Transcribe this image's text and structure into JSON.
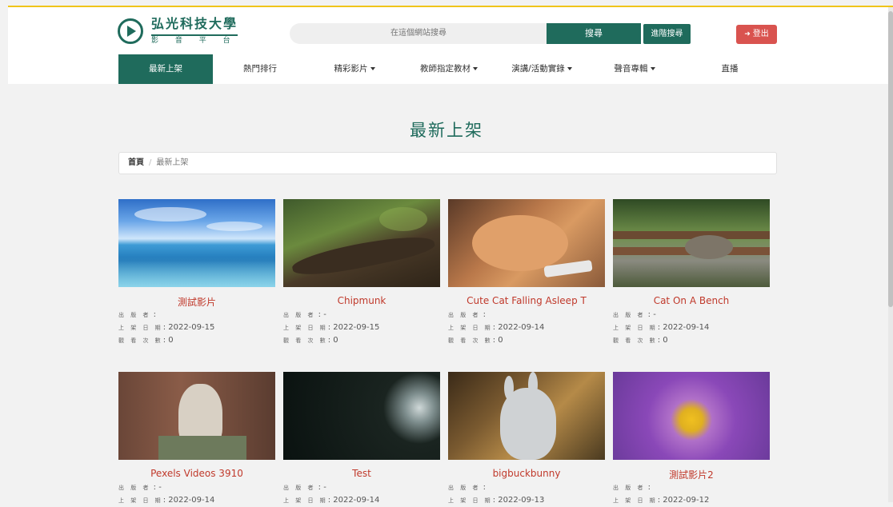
{
  "logo": {
    "name": "弘光科技大學",
    "subtitle": "影 音 平 台"
  },
  "search": {
    "placeholder": "在這個網站搜尋",
    "button": "搜尋",
    "advanced": "進階搜尋"
  },
  "logout": {
    "label": "登出",
    "icon": "logout-icon"
  },
  "nav": {
    "items": [
      {
        "label": "最新上架",
        "active": true,
        "dropdown": false
      },
      {
        "label": "熱門排行",
        "active": false,
        "dropdown": false
      },
      {
        "label": "精彩影片",
        "active": false,
        "dropdown": true
      },
      {
        "label": "教師指定教材",
        "active": false,
        "dropdown": true
      },
      {
        "label": "演講/活動實錄",
        "active": false,
        "dropdown": true
      },
      {
        "label": "聲音專輯",
        "active": false,
        "dropdown": true
      },
      {
        "label": "直播",
        "active": false,
        "dropdown": false
      }
    ]
  },
  "page": {
    "title": "最新上架"
  },
  "breadcrumb": {
    "home": "首頁",
    "separator": "/",
    "current": "最新上架"
  },
  "labels": {
    "publisher": "出 版 者",
    "date": "上 架 日 期",
    "views": "觀 看 次 數"
  },
  "videos": [
    {
      "title": "測試影片",
      "publisher": ":",
      "date": ": 2022-09-15",
      "views": ": 0"
    },
    {
      "title": "Chipmunk",
      "publisher": ": -",
      "date": ": 2022-09-15",
      "views": ": 0"
    },
    {
      "title": "Cute Cat Falling Asleep T",
      "publisher": ":",
      "date": ": 2022-09-14",
      "views": ": 0"
    },
    {
      "title": "Cat On A Bench",
      "publisher": ": -",
      "date": ": 2022-09-14",
      "views": ": 0"
    },
    {
      "title": "Pexels Videos 3910",
      "publisher": ": -",
      "date": ": 2022-09-14",
      "views": ""
    },
    {
      "title": "Test",
      "publisher": ": -",
      "date": ": 2022-09-14",
      "views": ""
    },
    {
      "title": "bigbuckbunny",
      "publisher": ":",
      "date": ": 2022-09-13",
      "views": ""
    },
    {
      "title": "測試影片2",
      "publisher": ":",
      "date": ": 2022-09-12",
      "views": ""
    }
  ],
  "colors": {
    "brand": "#1f6b5c",
    "title": "#c0392b",
    "logout": "#d9534f",
    "accent_line": "#f0c419"
  }
}
